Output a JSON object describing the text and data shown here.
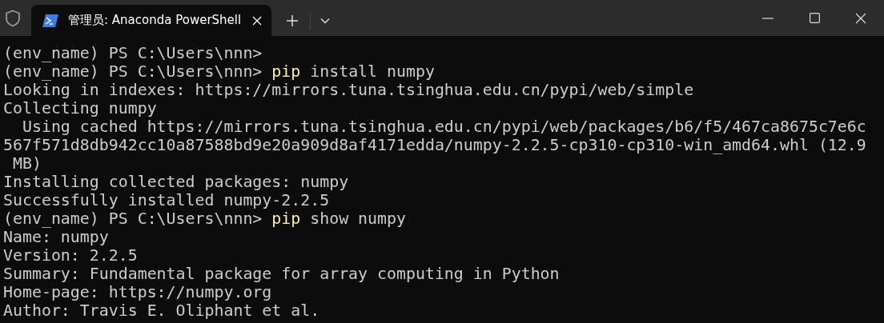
{
  "tab_bar": {
    "tabs": [
      {
        "title": "管理员: Anaconda PowerShell",
        "selected": true
      }
    ]
  },
  "terminal": {
    "lines": [
      {
        "segments": [
          {
            "kind": "output",
            "text": "(env_name) PS C:\\Users\\nnn>"
          }
        ]
      },
      {
        "segments": [
          {
            "kind": "output",
            "text": "(env_name) PS C:\\Users\\nnn> "
          },
          {
            "kind": "command",
            "text": "pip"
          },
          {
            "kind": "output",
            "text": " install numpy"
          }
        ]
      },
      {
        "segments": [
          {
            "kind": "output",
            "text": "Looking in indexes: https://mirrors.tuna.tsinghua.edu.cn/pypi/web/simple"
          }
        ]
      },
      {
        "segments": [
          {
            "kind": "output",
            "text": "Collecting numpy"
          }
        ]
      },
      {
        "segments": [
          {
            "kind": "output",
            "text": "  Using cached https://mirrors.tuna.tsinghua.edu.cn/pypi/web/packages/b6/f5/467ca8675c7e6c"
          }
        ]
      },
      {
        "segments": [
          {
            "kind": "output",
            "text": "567f571d8db942cc10a87588bd9e20a909d8af4171edda/numpy-2.2.5-cp310-cp310-win_amd64.whl (12.9"
          }
        ]
      },
      {
        "segments": [
          {
            "kind": "output",
            "text": " MB)"
          }
        ]
      },
      {
        "segments": [
          {
            "kind": "output",
            "text": "Installing collected packages: numpy"
          }
        ]
      },
      {
        "segments": [
          {
            "kind": "output",
            "text": "Successfully installed numpy-2.2.5"
          }
        ]
      },
      {
        "segments": [
          {
            "kind": "output",
            "text": "(env_name) PS C:\\Users\\nnn> "
          },
          {
            "kind": "command",
            "text": "pip"
          },
          {
            "kind": "output",
            "text": " show numpy"
          }
        ]
      },
      {
        "segments": [
          {
            "kind": "output",
            "text": "Name: numpy"
          }
        ]
      },
      {
        "segments": [
          {
            "kind": "output",
            "text": "Version: 2.2.5"
          }
        ]
      },
      {
        "segments": [
          {
            "kind": "output",
            "text": "Summary: Fundamental package for array computing in Python"
          }
        ]
      },
      {
        "segments": [
          {
            "kind": "output",
            "text": "Home-page: https://numpy.org"
          }
        ]
      },
      {
        "segments": [
          {
            "kind": "output",
            "text": "Author: Travis E. Oliphant et al."
          }
        ]
      }
    ]
  }
}
